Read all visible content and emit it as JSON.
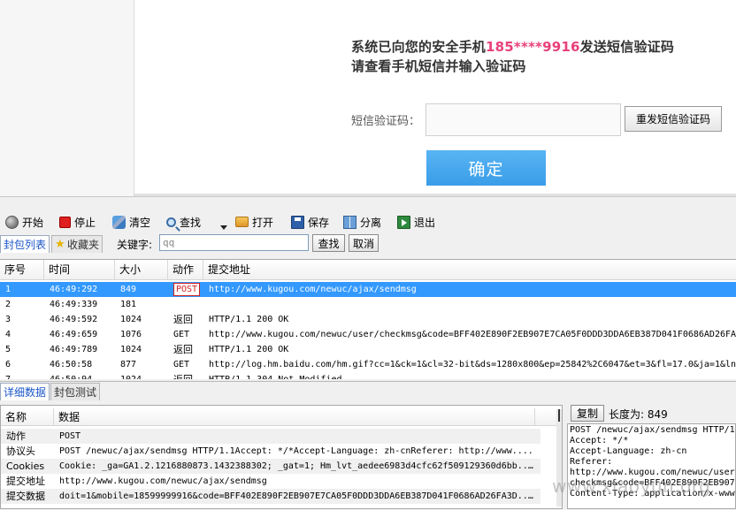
{
  "web": {
    "message_prefix": "系统已向您的安全手机",
    "phone": "185****9916",
    "message_suffix": "发送短信验证码",
    "message_line2": "请查看手机短信并输入验证码",
    "sms_label": "短信验证码：",
    "sms_value": "",
    "resend_label": "重发短信验证码",
    "confirm_label": "确定"
  },
  "toolbar": {
    "start": "开始",
    "stop": "停止",
    "clear": "清空",
    "find": "查找",
    "open": "打开",
    "save": "保存",
    "split": "分离",
    "exit": "退出"
  },
  "tabs_top": {
    "packet_list": "封包列表",
    "favorites": "收藏夹",
    "keyword_label": "关键字:",
    "keyword_value": "qq",
    "find_button": "查找",
    "cancel_button": "取消"
  },
  "packet_list": {
    "columns": [
      "序号",
      "时间",
      "大小",
      "动作",
      "提交地址"
    ],
    "rows": [
      {
        "no": "1",
        "time": "46:49:292",
        "size": "849",
        "action": "POST",
        "url": "http://www.kugou.com/newuc/ajax/sendmsg",
        "selected": true
      },
      {
        "no": "2",
        "time": "46:49:339",
        "size": "181",
        "action": "",
        "url": "",
        "selected": false
      },
      {
        "no": "3",
        "time": "46:49:592",
        "size": "1024",
        "action": "返回",
        "url": "HTTP/1.1 200 OK",
        "selected": false
      },
      {
        "no": "4",
        "time": "46:49:659",
        "size": "1076",
        "action": "GET",
        "url": "http://www.kugou.com/newuc/user/checkmsg&code=BFF402E890F2EB907E7CA05F0DDD3DDA6EB387D041F0686AD26FA3",
        "selected": false
      },
      {
        "no": "5",
        "time": "46:49:789",
        "size": "1024",
        "action": "返回",
        "url": "HTTP/1.1 200 OK",
        "selected": false
      },
      {
        "no": "6",
        "time": "46:50:58",
        "size": "877",
        "action": "GET",
        "url": "http://log.hm.baidu.com/hm.gif?cc=1&ck=1&cl=32-bit&ds=1280x800&ep=25842%2C6047&et=3&fl=17.0&ja=1&ln=",
        "selected": false
      },
      {
        "no": "7",
        "time": "46:50:94",
        "size": "1024",
        "action": "返回",
        "url": "HTTP/1.1 304 Not Modified",
        "selected": false
      }
    ]
  },
  "tabs_bottom": {
    "detail": "详细数据",
    "test": "封包测试"
  },
  "detail": {
    "columns": [
      "名称",
      "数据"
    ],
    "rows": [
      {
        "name": "动作",
        "value": "POST"
      },
      {
        "name": "协议头",
        "value": "POST /newuc/ajax/sendmsg HTTP/1.1Accept: */*Accept-Language: zh-cnReferer: http://www...."
      },
      {
        "name": "Cookies",
        "value": "Cookie: _ga=GA1.2.1216880873.1432388302; _gat=1; Hm_lvt_aedee6983d4cfc62f509129360d6bb...."
      },
      {
        "name": "提交地址",
        "value": "http://www.kugou.com/newuc/ajax/sendmsg"
      },
      {
        "name": "提交数据",
        "value": "doit=1&mobile=18599999916&code=BFF402E890F2EB907E7CA05F0DDD3DDA6EB387D041F0686AD26FA3D...."
      }
    ]
  },
  "raw": {
    "copy_label": "复制",
    "length_label": "长度为: 849",
    "lines": [
      "POST /newuc/ajax/sendmsg HTTP/1.1",
      "Accept: */*",
      "Accept-Language: zh-cn",
      "Referer:",
      "http://www.kugou.com/newuc/user/",
      "checkmsg&code=BFF402E890F2EB907E7CA05F0DDD3DDA6EB387",
      "Content-Type: application/x-www-"
    ]
  },
  "watermark": "www.xiaoyun.org"
}
